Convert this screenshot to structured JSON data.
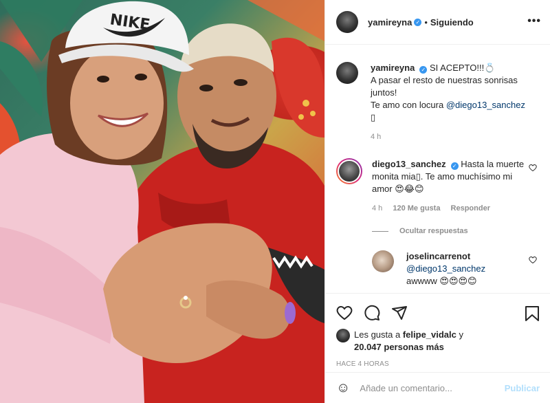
{
  "header": {
    "username": "yamireyna",
    "verified_mark": "✓",
    "separator": "•",
    "follow_status": "Siguiendo",
    "more_label": "•••"
  },
  "caption": {
    "username": "yamireyna",
    "text_1": "SI ACEPTO!!!💍",
    "text_2": "A pasar el resto de nuestras sonrisas juntos!",
    "text_3": "Te amo con locura",
    "mention": "@diego13_sanchez",
    "text_4": "▯",
    "time": "4 h"
  },
  "comments": [
    {
      "username": "diego13_sanchez",
      "text": "Hasta la muerte monita mia▯. Te amo muchísimo mi amor 😍😂😊",
      "time": "4 h",
      "likes": "120 Me gusta",
      "reply_label": "Responder"
    }
  ],
  "hide_replies_label": "Ocultar respuestas",
  "reply": {
    "username": "joselincarrenot",
    "mention": "@diego13_sanchez",
    "text": "awwww 😍😍😍😊"
  },
  "likes": {
    "prefix": "Les gusta a",
    "user": "felipe_vidalc",
    "connector": "y",
    "count": "20.047 personas más"
  },
  "posted_ago": "HACE 4 HORAS",
  "add_comment": {
    "placeholder": "Añade un comentario...",
    "publish_label": "Publicar",
    "emoji_icon": "☺"
  },
  "photo": {
    "cap_brand": "NIKE"
  },
  "colors": {
    "accent": "#3897f0",
    "mention": "#00376b",
    "muted": "#8e8e8e",
    "publish_disabled": "#b2dffc"
  }
}
